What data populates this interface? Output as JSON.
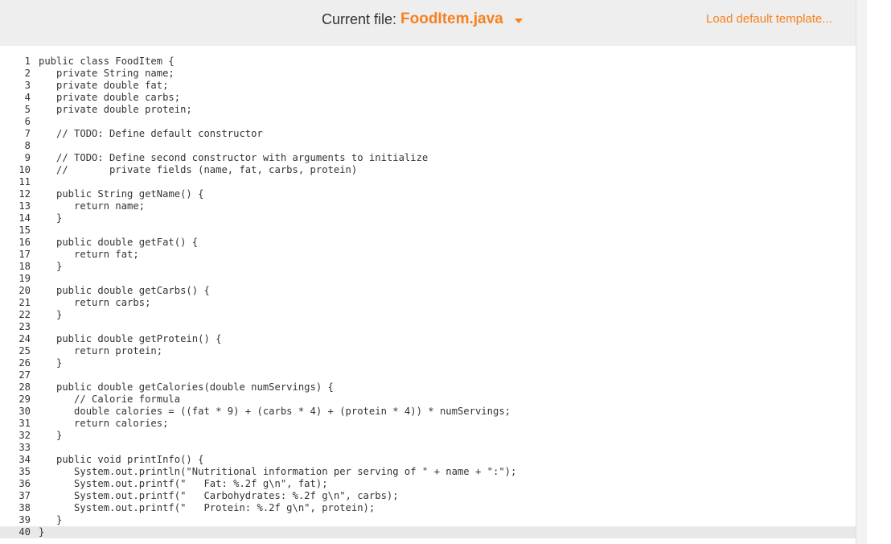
{
  "header": {
    "current_file_label": "Current file:",
    "current_file_name": "FoodItem.java",
    "load_default_label": "Load default template...",
    "accent_color": "#f5821f"
  },
  "editor": {
    "line_numbers": [
      "1",
      "2",
      "3",
      "4",
      "5",
      "6",
      "7",
      "8",
      "9",
      "10",
      "11",
      "12",
      "13",
      "14",
      "15",
      "16",
      "17",
      "18",
      "19",
      "20",
      "21",
      "22",
      "23",
      "24",
      "25",
      "26",
      "27",
      "28",
      "29",
      "30",
      "31",
      "32",
      "33",
      "34",
      "35",
      "36",
      "37",
      "38",
      "39",
      "40"
    ],
    "lines": [
      "public class FoodItem {",
      "   private String name;",
      "   private double fat;",
      "   private double carbs;",
      "   private double protein;",
      "",
      "   // TODO: Define default constructor",
      "",
      "   // TODO: Define second constructor with arguments to initialize",
      "   //       private fields (name, fat, carbs, protein)",
      "",
      "   public String getName() {",
      "      return name;",
      "   }",
      "",
      "   public double getFat() {",
      "      return fat;",
      "   }",
      "",
      "   public double getCarbs() {",
      "      return carbs;",
      "   }",
      "",
      "   public double getProtein() {",
      "      return protein;",
      "   }",
      "",
      "   public double getCalories(double numServings) {",
      "      // Calorie formula",
      "      double calories = ((fat * 9) + (carbs * 4) + (protein * 4)) * numServings;",
      "      return calories;",
      "   }",
      "",
      "   public void printInfo() {",
      "      System.out.println(\"Nutritional information per serving of \" + name + \":\");",
      "      System.out.printf(\"   Fat: %.2f g\\n\", fat);",
      "      System.out.printf(\"   Carbohydrates: %.2f g\\n\", carbs);",
      "      System.out.printf(\"   Protein: %.2f g\\n\", protein);",
      "   }",
      "}"
    ],
    "active_line": 40
  }
}
